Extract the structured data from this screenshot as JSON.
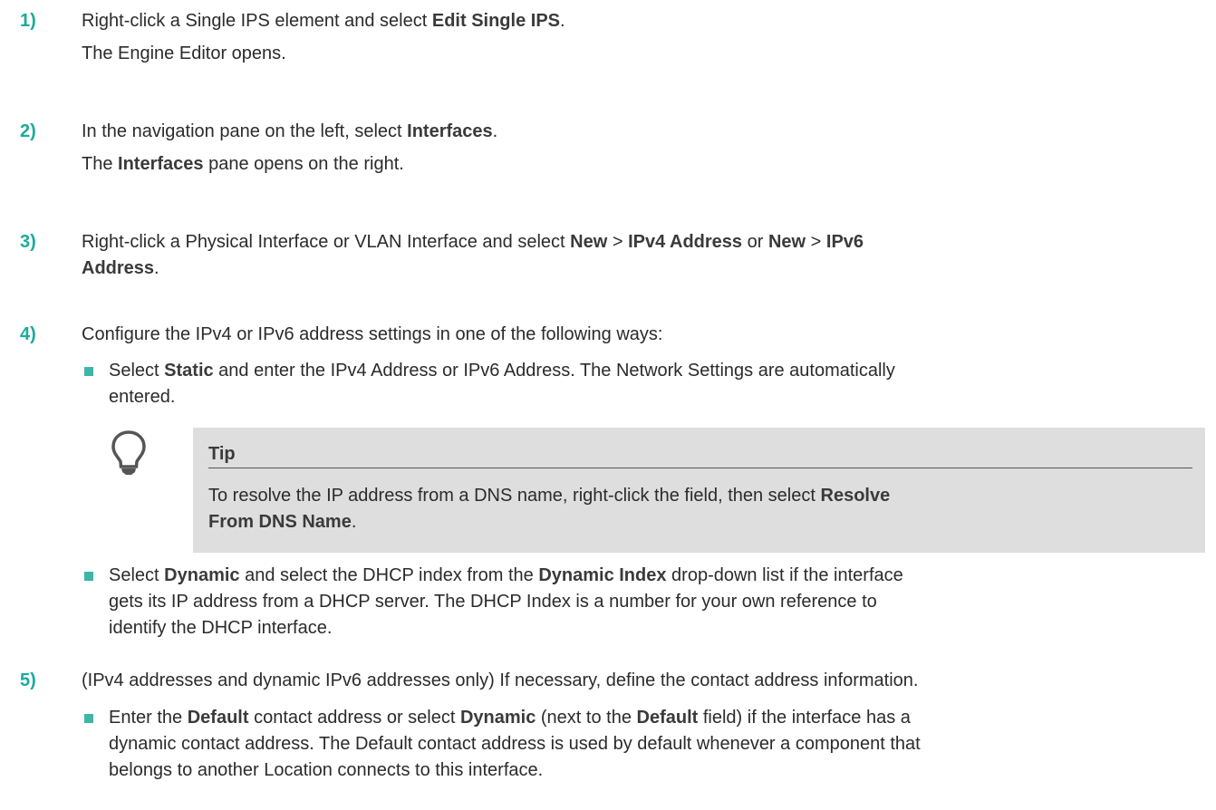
{
  "steps": [
    {
      "num": "1)",
      "lines": [
        [
          {
            "t": "Right-click a Single IPS element and select "
          },
          {
            "b": "Edit Single IPS"
          },
          {
            "t": "."
          }
        ],
        [
          {
            "t": "The Engine Editor opens."
          }
        ]
      ]
    },
    {
      "num": "2)",
      "lines": [
        [
          {
            "t": "In the navigation pane on the left, select "
          },
          {
            "b": "Interfaces"
          },
          {
            "t": "."
          }
        ],
        [
          {
            "t": "The "
          },
          {
            "b": "Interfaces"
          },
          {
            "t": " pane opens on the right."
          }
        ]
      ]
    },
    {
      "num": "3)",
      "lines": [
        [
          {
            "t": "Right-click a Physical Interface or VLAN Interface and select "
          },
          {
            "b": "New"
          },
          {
            "t": " > "
          },
          {
            "b": "IPv4 Address"
          },
          {
            "t": " or "
          },
          {
            "b": "New"
          },
          {
            "t": " > "
          },
          {
            "b": "IPv6"
          }
        ],
        [
          {
            "b": "Address"
          },
          {
            "t": "."
          }
        ]
      ]
    },
    {
      "num": "4)",
      "lines": [
        [
          {
            "t": "Configure the IPv4 or IPv6 address settings in one of the following ways:"
          }
        ]
      ]
    },
    {
      "num": "5)",
      "lines": [
        [
          {
            "t": "(IPv4 addresses and dynamic IPv6 addresses only) If necessary, define the contact address information."
          }
        ]
      ]
    }
  ],
  "bullets_step4": [
    {
      "lines": [
        [
          {
            "t": "Select "
          },
          {
            "b": "Static"
          },
          {
            "t": " and enter the IPv4 Address or IPv6 Address. The Network Settings are automatically"
          }
        ],
        [
          {
            "t": "entered."
          }
        ]
      ]
    },
    {
      "lines": [
        [
          {
            "t": "Select "
          },
          {
            "b": "Dynamic"
          },
          {
            "t": " and select the DHCP index from the "
          },
          {
            "b": "Dynamic Index"
          },
          {
            "t": " drop-down list if the interface"
          }
        ],
        [
          {
            "t": "gets its IP address from a DHCP server. The DHCP Index is a number for your own reference to"
          }
        ],
        [
          {
            "t": "identify the DHCP interface."
          }
        ]
      ]
    }
  ],
  "tip": {
    "title": "Tip",
    "lines": [
      [
        {
          "t": "To resolve the IP address from a DNS name, right-click the field, then select "
        },
        {
          "b": "Resolve"
        }
      ],
      [
        {
          "b": "From DNS Name"
        },
        {
          "t": "."
        }
      ]
    ]
  },
  "bullets_step5": [
    {
      "lines": [
        [
          {
            "t": "Enter the "
          },
          {
            "b": "Default"
          },
          {
            "t": " contact address or select "
          },
          {
            "b": "Dynamic"
          },
          {
            "t": " (next to the "
          },
          {
            "b": "Default"
          },
          {
            "t": " field) if the interface has a"
          }
        ],
        [
          {
            "t": "dynamic contact address. The Default contact address is used by default whenever a component that"
          }
        ],
        [
          {
            "t": "belongs to another Location connects to this interface."
          }
        ]
      ]
    }
  ],
  "colors": {
    "step_number": "#1aab9b",
    "bullet": "#3fb5a8",
    "tip_background": "#dedede"
  },
  "icons": {
    "tip": "lightbulb-icon",
    "bullet": "square-bullet-icon"
  }
}
